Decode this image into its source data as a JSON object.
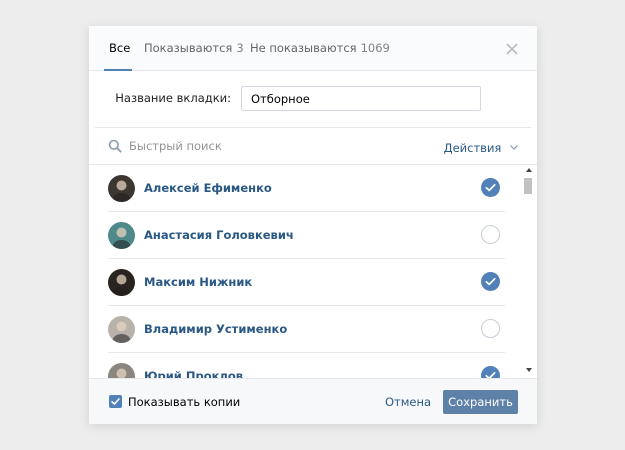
{
  "tabs": [
    {
      "label": "Все",
      "count": "",
      "active": true
    },
    {
      "label": "Показываются",
      "count": "3",
      "active": false
    },
    {
      "label": "Не показываются",
      "count": "1069",
      "active": false
    }
  ],
  "name_field": {
    "label": "Название вкладки:",
    "value": "Отборное"
  },
  "search": {
    "placeholder": "Быстрый поиск",
    "value": ""
  },
  "actions_label": "Действия",
  "users": [
    {
      "name": "Алексей Ефименко",
      "checked": true,
      "avatar_color": "#3d3732"
    },
    {
      "name": "Анастасия Головкевич",
      "checked": false,
      "avatar_color": "#4f8a8a"
    },
    {
      "name": "Максим Нижник",
      "checked": true,
      "avatar_color": "#2a2420"
    },
    {
      "name": "Владимир Устименко",
      "checked": false,
      "avatar_color": "#b9b2ab"
    },
    {
      "name": "Юрий Проклов",
      "checked": true,
      "avatar_color": "#8a8680"
    }
  ],
  "footer": {
    "show_copies_label": "Показывать копии",
    "show_copies_checked": true,
    "cancel_label": "Отмена",
    "save_label": "Сохранить"
  },
  "colors": {
    "accent": "#5181b8",
    "link": "#2a5885",
    "save_button": "#5e81a8",
    "background": "#ededed"
  }
}
